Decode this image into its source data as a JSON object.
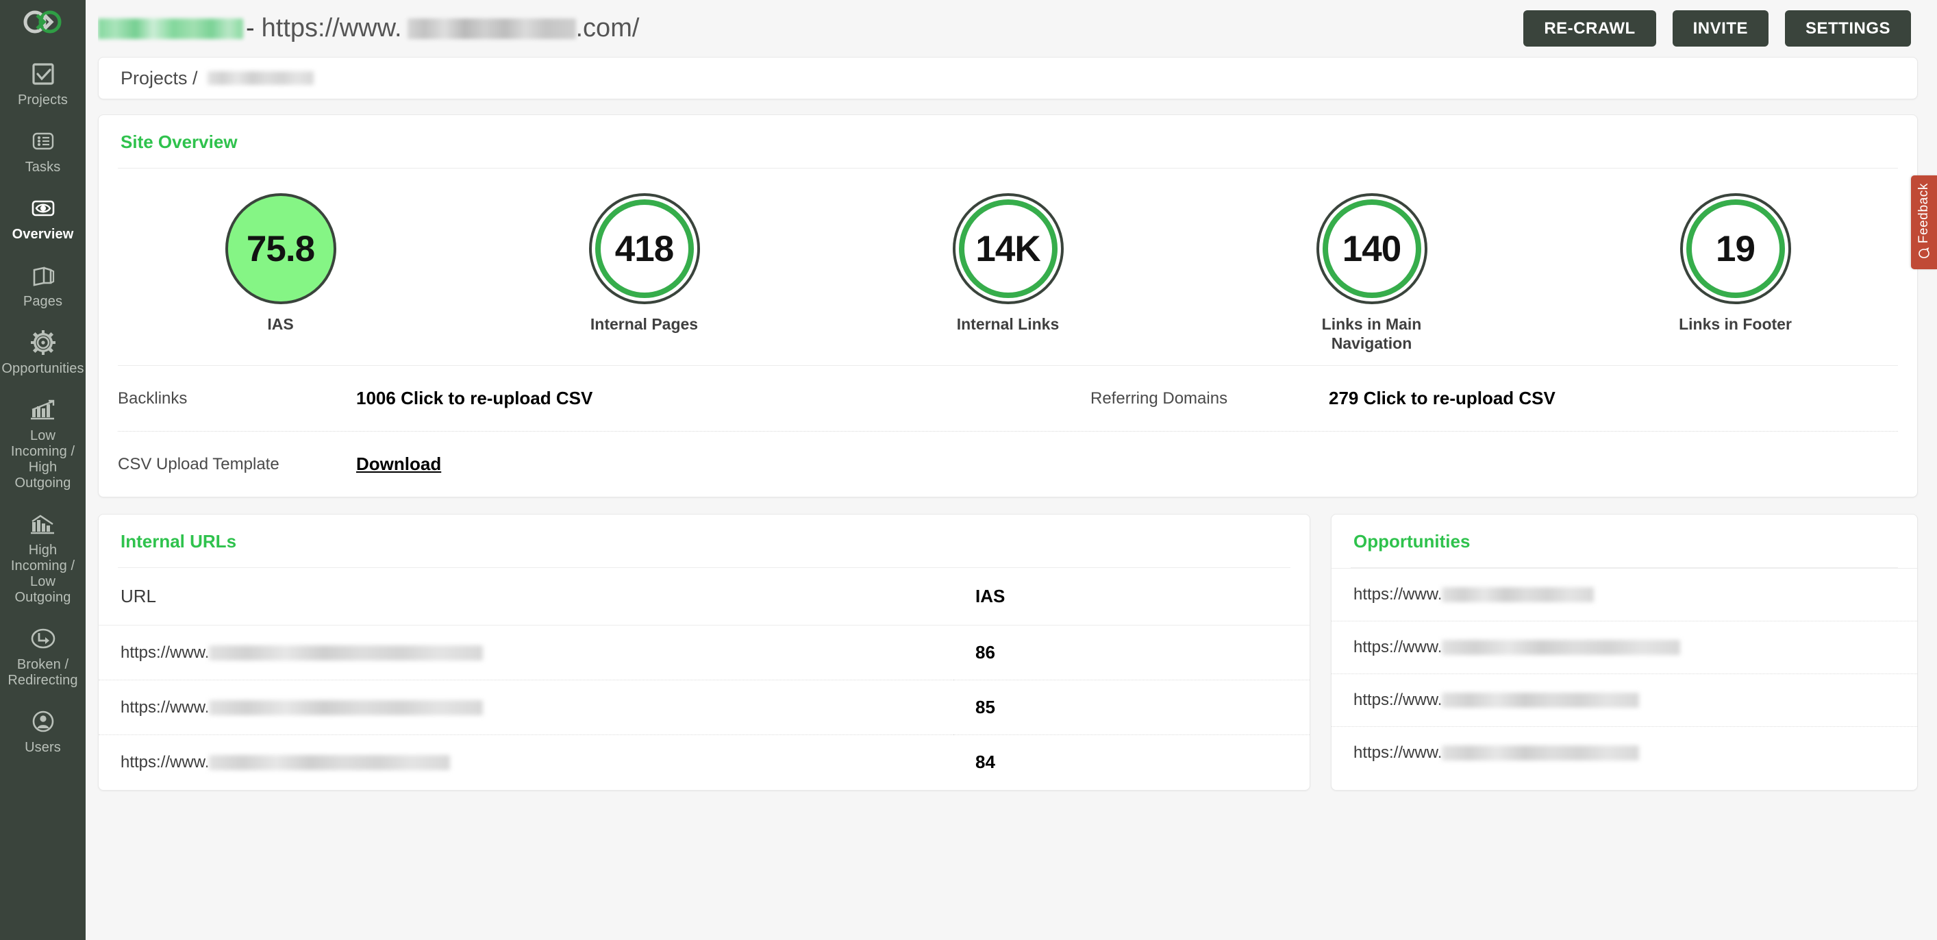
{
  "brand": {
    "logo_icon": "interlocking-links-logo",
    "accent_green": "#2fc24d",
    "sidebar_bg": "#3a443c",
    "gauge_ring_dark": "#3a443c",
    "gauge_ring_green": "#36ad4b",
    "gauge_fill_green": "#85f585",
    "feedback_red": "#c04a36"
  },
  "sidebar": {
    "items": [
      {
        "label": "Projects",
        "icon": "checkbox-icon",
        "active": false
      },
      {
        "label": "Tasks",
        "icon": "list-icon",
        "active": false
      },
      {
        "label": "Overview",
        "icon": "eye-icon",
        "active": true
      },
      {
        "label": "Pages",
        "icon": "pages-icon",
        "active": false
      },
      {
        "label": "Opportunities",
        "icon": "gear-icon",
        "active": false
      },
      {
        "label": "Low Incoming / High Outgoing",
        "icon": "bar-chart-up-icon",
        "active": false
      },
      {
        "label": "High Incoming / Low Outgoing",
        "icon": "bar-chart-down-icon",
        "active": false
      },
      {
        "label": "Broken / Redirecting",
        "icon": "redirect-arrow-icon",
        "active": false
      },
      {
        "label": "Users",
        "icon": "user-icon",
        "active": false
      }
    ]
  },
  "topbar": {
    "project_name_redacted": true,
    "separator": "-",
    "url_prefix": "https://www.",
    "url_suffix": ".com/",
    "buttons": [
      {
        "label": "RE-CRAWL"
      },
      {
        "label": "INVITE"
      },
      {
        "label": "SETTINGS"
      }
    ]
  },
  "breadcrumb": {
    "root": "Projects /",
    "current_redacted": true
  },
  "site_overview": {
    "title": "Site Overview",
    "metrics": [
      {
        "value": "75.8",
        "label": "IAS",
        "style": "filled"
      },
      {
        "value": "418",
        "label": "Internal Pages",
        "style": "ring"
      },
      {
        "value": "14K",
        "label": "Internal Links",
        "style": "ring"
      },
      {
        "value": "140",
        "label": "Links in Main Navigation",
        "style": "ring"
      },
      {
        "value": "19",
        "label": "Links in Footer",
        "style": "ring"
      }
    ],
    "rows": [
      {
        "label_left": "Backlinks",
        "value_left": "1006 Click to re-upload CSV",
        "label_right": "Referring Domains",
        "value_right": "279 Click to re-upload CSV"
      }
    ],
    "template_row": {
      "label": "CSV Upload Template",
      "link": "Download"
    }
  },
  "internal_urls": {
    "title": "Internal URLs",
    "columns": [
      "URL",
      "IAS"
    ],
    "rows": [
      {
        "url_prefix": "https://www.",
        "url_redacted_width": 400,
        "ias": "86"
      },
      {
        "url_prefix": "https://www.",
        "url_redacted_width": 400,
        "ias": "85"
      },
      {
        "url_prefix": "https://www.",
        "url_redacted_width": 352,
        "ias": "84"
      }
    ]
  },
  "opportunities": {
    "title": "Opportunities",
    "rows": [
      {
        "url_prefix": "https://www.",
        "url_redacted_width": 222
      },
      {
        "url_prefix": "https://www.",
        "url_redacted_width": 348
      },
      {
        "url_prefix": "https://www.",
        "url_redacted_width": 288
      },
      {
        "url_prefix": "https://www.",
        "url_redacted_width": 288
      }
    ]
  },
  "feedback": {
    "label": "Feedback",
    "icon": "speech-bubble-icon"
  }
}
